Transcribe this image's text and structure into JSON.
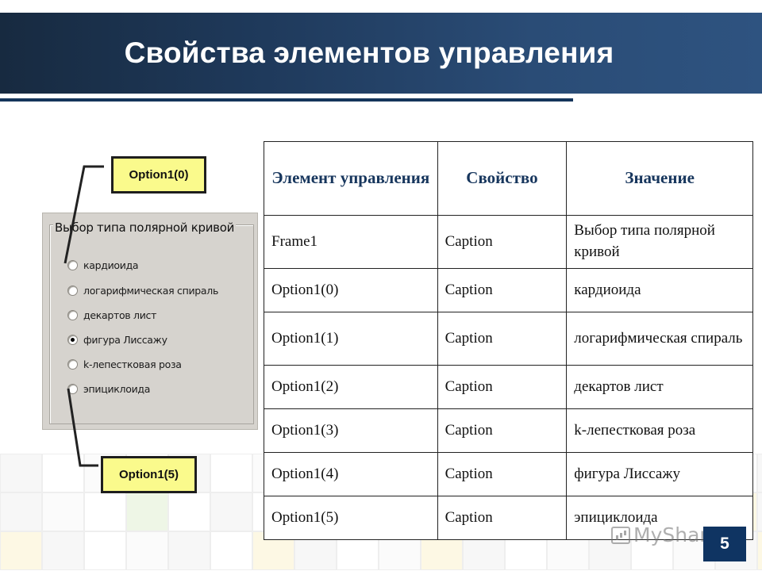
{
  "slide": {
    "title": "Свойства элементов управления",
    "number": "5",
    "watermark": "MyShared",
    "colors": {
      "header_dark": "#172a40",
      "header_light": "#2e5380",
      "accent_navy": "#0f3462",
      "callout_fill": "#fafa8c",
      "table_header_text": "#17365d",
      "frame_bg": "#d6d3ce"
    }
  },
  "vb_frame": {
    "caption": "Выбор типа полярной кривой",
    "options": [
      {
        "label": "кардиоида",
        "checked": false
      },
      {
        "label": "логарифмическая спираль",
        "checked": false
      },
      {
        "label": "декартов лист",
        "checked": false
      },
      {
        "label": "фигура Лиссажу",
        "checked": true
      },
      {
        "label": "k-лепестковая роза",
        "checked": false
      },
      {
        "label": "эпициклоида",
        "checked": false
      }
    ]
  },
  "callouts": {
    "top": "Option1(0)",
    "bottom": "Option1(5)"
  },
  "table": {
    "headers": [
      "Элемент управления",
      "Свойство",
      "Значение"
    ],
    "rows": [
      {
        "control": "Frame1",
        "property": "Caption",
        "value": "Выбор типа полярной кривой"
      },
      {
        "control": "Option1(0)",
        "property": "Caption",
        "value": "кардиоида"
      },
      {
        "control": "Option1(1)",
        "property": "Caption",
        "value": "логарифмическая спираль"
      },
      {
        "control": "Option1(2)",
        "property": "Caption",
        "value": "декартов лист"
      },
      {
        "control": "Option1(3)",
        "property": "Caption",
        "value": "k-лепестковая роза"
      },
      {
        "control": "Option1(4)",
        "property": "Caption",
        "value": "фигура Лиссажу"
      },
      {
        "control": "Option1(5)",
        "property": "Caption",
        "value": "эпициклоида"
      }
    ]
  }
}
